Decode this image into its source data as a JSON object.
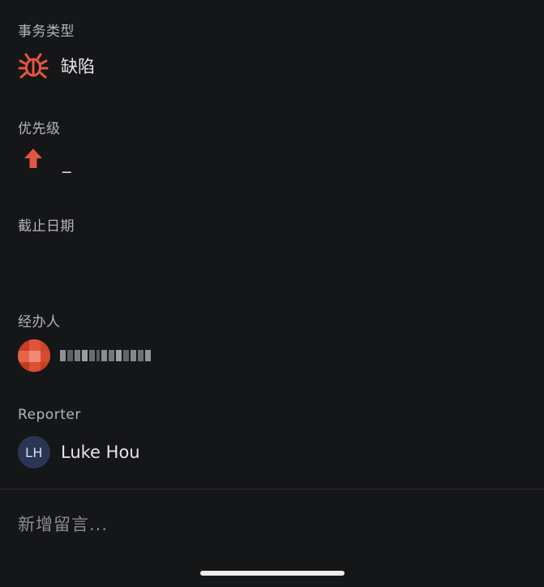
{
  "fields": {
    "issue_type": {
      "label": "事务类型",
      "value": "缺陷",
      "icon": "bug-icon",
      "icon_color": "#e2563f"
    },
    "priority": {
      "label": "优先级",
      "value": "_",
      "icon": "arrow-up-icon",
      "icon_color": "#e2563f"
    },
    "due_date": {
      "label": "截止日期",
      "value": ""
    },
    "assignee": {
      "label": "经办人",
      "avatar": "pixelated-avatar",
      "name_obscured": true
    },
    "reporter": {
      "label": "Reporter",
      "avatar_initials": "LH",
      "name": "Luke Hou"
    }
  },
  "comment": {
    "placeholder": "新增留言..."
  }
}
